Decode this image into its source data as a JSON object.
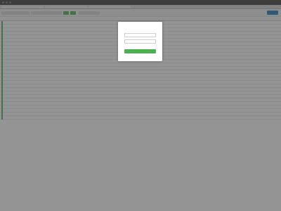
{
  "login": {
    "username_value": "",
    "password_value": "",
    "submit_label": ""
  }
}
